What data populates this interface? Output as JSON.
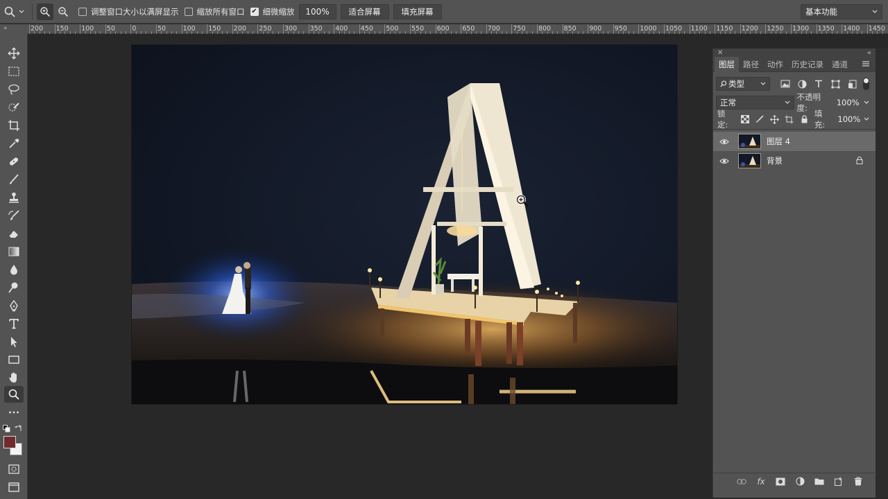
{
  "options_bar": {
    "resize_windows_label": "调整窗口大小以满屏显示",
    "resize_windows_checked": false,
    "zoom_all_windows_label": "缩放所有窗口",
    "zoom_all_windows_checked": false,
    "scrubby_zoom_label": "细微缩放",
    "scrubby_zoom_checked": true,
    "zoom_value": "100%",
    "fit_screen_label": "适合屏幕",
    "fill_screen_label": "填充屏幕",
    "workspace": "基本功能"
  },
  "ruler": {
    "corner": "»",
    "labels": [
      "200",
      "150",
      "100",
      "50",
      "0",
      "50",
      "100",
      "150",
      "200",
      "250",
      "300",
      "350",
      "400",
      "450",
      "500",
      "550",
      "600",
      "650",
      "700",
      "750",
      "800",
      "850",
      "900",
      "950",
      "1000",
      "1050",
      "1100",
      "1150",
      "1200",
      "1250",
      "1300",
      "1350",
      "1400",
      "1450"
    ]
  },
  "layers_panel": {
    "tabs": [
      "图层",
      "路径",
      "动作",
      "历史记录",
      "通道"
    ],
    "active_tab": "图层",
    "filter_kind": "类型",
    "blend_mode": "正常",
    "opacity_label": "不透明度:",
    "opacity_value": "100%",
    "lock_label": "锁定:",
    "fill_label": "填充:",
    "fill_value": "100%",
    "layers": [
      {
        "name": "图层 4",
        "visible": true,
        "selected": true,
        "locked": false
      },
      {
        "name": "背景",
        "visible": true,
        "selected": false,
        "locked": true
      }
    ],
    "fx_label": "fx"
  },
  "colors": {
    "foreground": "#6e2a2d",
    "background": "#f2f2f2"
  }
}
